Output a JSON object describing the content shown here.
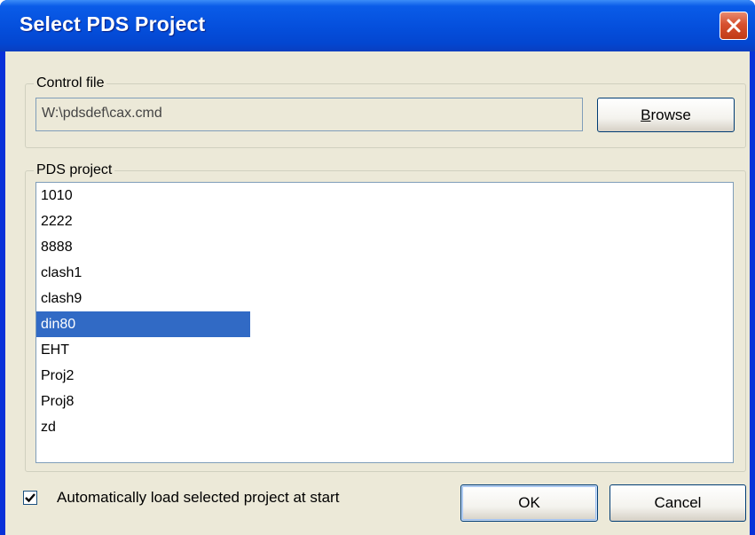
{
  "window": {
    "title": "Select PDS Project",
    "close_icon": "close-icon"
  },
  "control_file": {
    "legend": "Control file",
    "value": "W:\\pdsdef\\cax.cmd",
    "browse_label_first": "B",
    "browse_label_rest": "rowse"
  },
  "project": {
    "legend": "PDS project",
    "items": [
      "1010",
      "2222",
      "8888",
      "clash1",
      "clash9",
      "din80",
      "EHT",
      "Proj2",
      "Proj8",
      "zd"
    ],
    "selected": "din80"
  },
  "footer": {
    "autoload_label": "Automatically load selected project at start",
    "autoload_checked": true,
    "ok_label": "OK",
    "cancel_label": "Cancel"
  },
  "colors": {
    "selection": "#316ac5",
    "face": "#ece9d8",
    "title_blue": "#0550dd",
    "close_red": "#d6502f"
  }
}
